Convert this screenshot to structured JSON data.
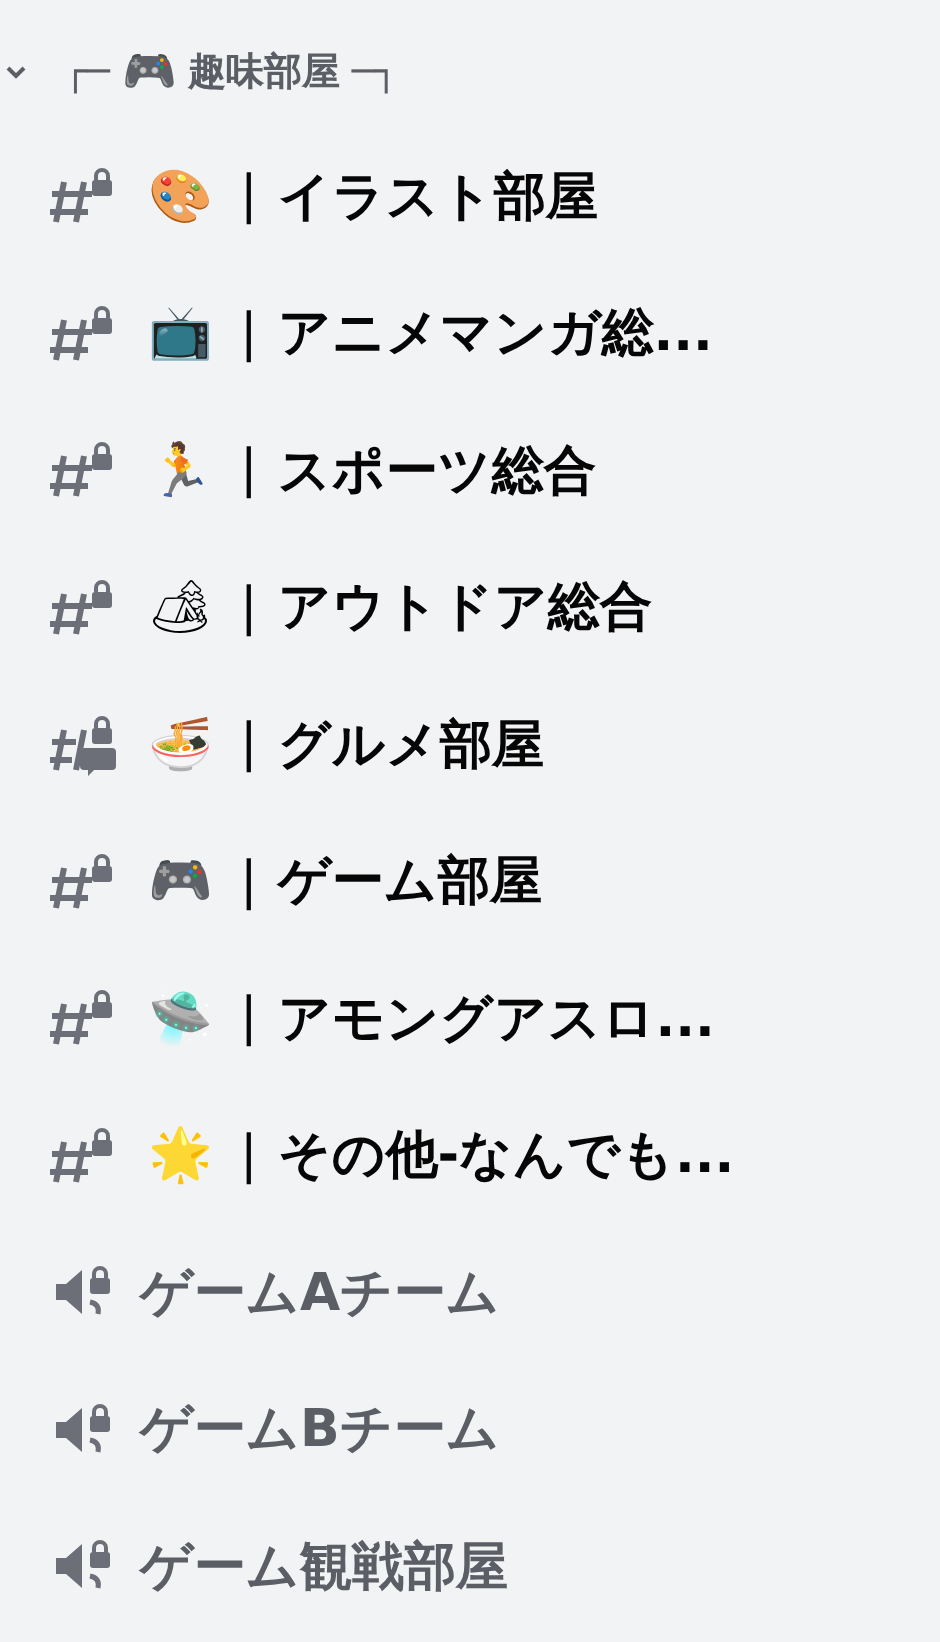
{
  "category": {
    "expanded": true,
    "left_mark": "┌─",
    "emoji": "🎮",
    "name": "趣味部屋",
    "right_mark": "─┐"
  },
  "channels": [
    {
      "kind": "text",
      "locked": true,
      "unread": true,
      "emoji": "🎨",
      "separator": "|",
      "name": "イラスト部屋"
    },
    {
      "kind": "text",
      "locked": true,
      "unread": true,
      "emoji": "📺",
      "separator": "|",
      "name": "アニメマンガ総..."
    },
    {
      "kind": "text",
      "locked": true,
      "unread": true,
      "emoji": "🏃",
      "separator": "|",
      "name": "スポーツ総合"
    },
    {
      "kind": "text",
      "locked": true,
      "unread": true,
      "emoji": "🏕",
      "separator": "|",
      "name": "アウトドア総合"
    },
    {
      "kind": "forum",
      "locked": true,
      "unread": true,
      "emoji": "🍜",
      "separator": "|",
      "name": "グルメ部屋"
    },
    {
      "kind": "text",
      "locked": true,
      "unread": true,
      "emoji": "🎮",
      "separator": "|",
      "name": "ゲーム部屋"
    },
    {
      "kind": "text",
      "locked": true,
      "unread": true,
      "emoji": "🛸",
      "separator": "|",
      "name": "アモングアスロ..."
    },
    {
      "kind": "text",
      "locked": true,
      "unread": true,
      "emoji": "🌟",
      "separator": "|",
      "name": "その他-なんでも..."
    },
    {
      "kind": "voice",
      "locked": true,
      "unread": false,
      "name": "ゲームAチーム"
    },
    {
      "kind": "voice",
      "locked": true,
      "unread": false,
      "name": "ゲームBチーム"
    },
    {
      "kind": "voice",
      "locked": true,
      "unread": false,
      "name": "ゲーム観戦部屋"
    }
  ]
}
